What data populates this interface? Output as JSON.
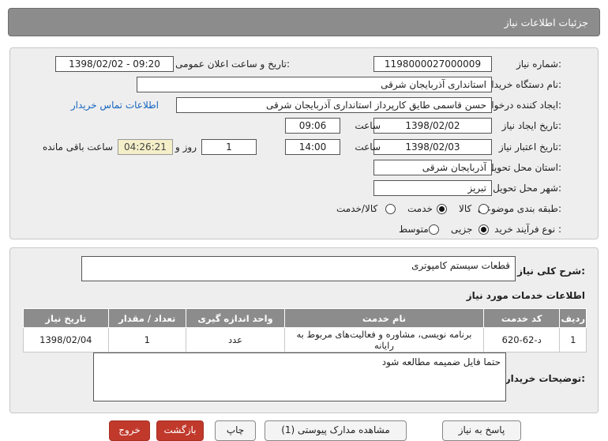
{
  "header": {
    "title": "جزئیات اطلاعات نیاز"
  },
  "info": {
    "need_number_label": "شماره نیاز:",
    "need_number": "1198000027000009",
    "announce_label": "تاریخ و ساعت اعلان عمومی:",
    "announce_value": "1398/02/02 - 09:20",
    "buyer_org_label": "نام دستگاه خریدار:",
    "buyer_org": "استانداری آذربایجان شرقی",
    "creator_label": "ایجاد کننده درخواست:",
    "creator": "حسن قاسمی طایق کارپرداز استانداری آذربایجان شرقی",
    "contact_link": "اطلاعات تماس خریدار",
    "created_date_label": "تاریخ ایجاد نیاز:",
    "created_date": "1398/02/02",
    "time_label": "ساعت",
    "created_time": "09:06",
    "valid_date_label": "تاریخ اعتبار نیاز:",
    "valid_date": "1398/02/03",
    "valid_time": "14:00",
    "days_value": "1",
    "days_label": "روز و",
    "remaining_time": "04:26:21",
    "remaining_label": "ساعت باقی مانده",
    "province_label": "استان محل تحویل:",
    "province": "آذربایجان شرقی",
    "city_label": "شهر محل تحویل:",
    "city": "تبریز",
    "category_label": "طبقه بندی موضوعی:",
    "category_options": [
      "کالا",
      "خدمت",
      "کالا/خدمت"
    ],
    "category_selected": "خدمت",
    "process_label": "نوع فرآیند خرید :",
    "process_options": [
      "جزیی",
      "متوسط"
    ],
    "process_selected": "جزیی"
  },
  "details": {
    "summary_label": "شرح کلی نیاز:",
    "summary": "قطعات سیستم کامپوتری",
    "services_title": "اطلاعات خدمات مورد نیاز",
    "table_headers": [
      "ردیف",
      "کد خدمت",
      "نام خدمت",
      "واحد اندازه گیری",
      "تعداد / مقدار",
      "تاریخ نیاز"
    ],
    "rows": [
      [
        "1",
        "د-62-620",
        "برنامه نویسی، مشاوره و فعالیت‌های مربوط به رایانه",
        "عدد",
        "1",
        "1398/02/04"
      ]
    ],
    "buyer_notes_label": "توضیحات خریدار:",
    "buyer_notes": "حتما فایل ضمیمه مطالعه شود"
  },
  "buttons": {
    "reply": "پاسخ به نیاز",
    "view_docs": "مشاهده مدارک پیوستی (1)",
    "print": "چاپ",
    "back": "بازگشت",
    "exit": "خروج"
  }
}
